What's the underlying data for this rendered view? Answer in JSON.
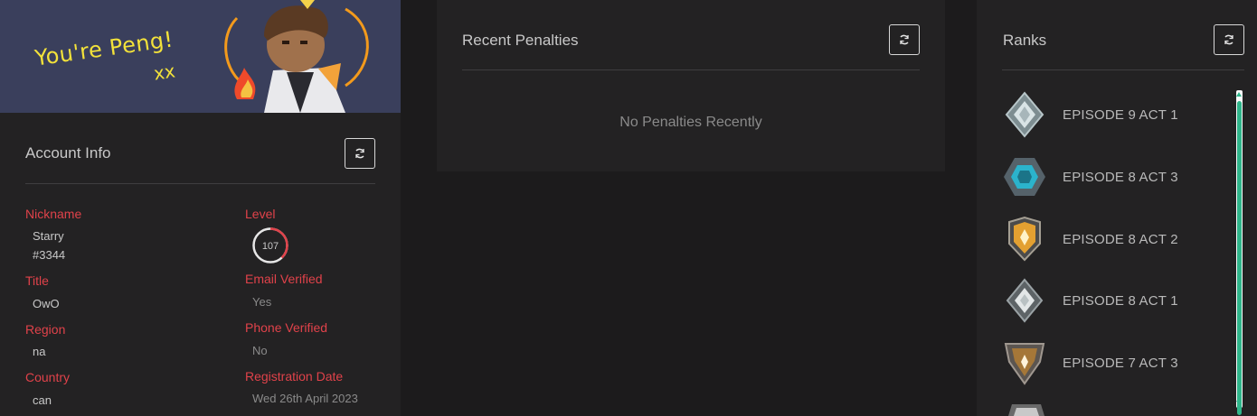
{
  "banner": {
    "text": "You're Peng!",
    "xx": "xx"
  },
  "account": {
    "title": "Account Info",
    "fields_left": [
      {
        "label": "Nickname",
        "value": "Starry",
        "value2": "#3344"
      },
      {
        "label": "Title",
        "value": "OwO"
      },
      {
        "label": "Region",
        "value": "na"
      },
      {
        "label": "Country",
        "value": "can"
      }
    ],
    "fields_right": [
      {
        "label": "Level",
        "value": "107",
        "progress": 0.38
      },
      {
        "label": "Email Verified",
        "value": "Yes"
      },
      {
        "label": "Phone Verified",
        "value": "No"
      },
      {
        "label": "Registration Date",
        "value": "Wed 26th April 2023"
      }
    ]
  },
  "penalties": {
    "title": "Recent Penalties",
    "empty_text": "No Penalties Recently"
  },
  "ranks": {
    "title": "Ranks",
    "items": [
      {
        "label": "EPISODE 9 ACT 1",
        "icon": "platinum-rank-icon"
      },
      {
        "label": "EPISODE 8 ACT 3",
        "icon": "diamond-rank-icon"
      },
      {
        "label": "EPISODE 8 ACT 2",
        "icon": "gold-rank-icon"
      },
      {
        "label": "EPISODE 8 ACT 1",
        "icon": "silver-rank-icon"
      },
      {
        "label": "EPISODE 7 ACT 3",
        "icon": "bronze-rank-icon"
      }
    ]
  },
  "colors": {
    "accent_red": "#e0424a",
    "scroll_green": "#2fb58a",
    "panel_bg": "#232223",
    "page_bg": "#1c1b1c"
  }
}
